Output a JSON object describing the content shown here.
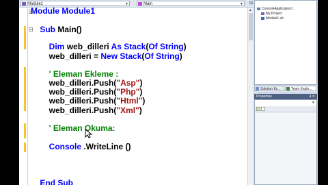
{
  "editor": {
    "class_dropdown": "Module1",
    "method_dropdown": "Main",
    "lines": [
      [
        {
          "t": "Module ",
          "c": "kw"
        },
        {
          "t": "Module1",
          "c": "kw"
        }
      ],
      [],
      [
        {
          "t": "    Sub ",
          "c": "kw"
        },
        {
          "t": "Main()",
          "c": "tx"
        }
      ],
      [],
      [
        {
          "t": "        Dim ",
          "c": "kw"
        },
        {
          "t": "web_dilleri ",
          "c": "tx"
        },
        {
          "t": "As Stack",
          "c": "kw"
        },
        {
          "t": "(",
          "c": "tx"
        },
        {
          "t": "Of String",
          "c": "kw"
        },
        {
          "t": ")",
          "c": "tx"
        }
      ],
      [
        {
          "t": "        web_dilleri = ",
          "c": "tx"
        },
        {
          "t": "New Stack",
          "c": "kw"
        },
        {
          "t": "(",
          "c": "tx"
        },
        {
          "t": "Of String",
          "c": "kw"
        },
        {
          "t": ")",
          "c": "tx"
        }
      ],
      [],
      [
        {
          "t": "        ' Eleman Ekleme :",
          "c": "cm"
        }
      ],
      [
        {
          "t": "        web_dilleri.Push(",
          "c": "tx"
        },
        {
          "t": "\"Asp\"",
          "c": "str"
        },
        {
          "t": ")",
          "c": "tx"
        }
      ],
      [
        {
          "t": "        web_dilleri.Push(",
          "c": "tx"
        },
        {
          "t": "\"Php\"",
          "c": "str"
        },
        {
          "t": ")",
          "c": "tx"
        }
      ],
      [
        {
          "t": "        web_dilleri.Push(",
          "c": "tx"
        },
        {
          "t": "\"Html\"",
          "c": "str"
        },
        {
          "t": ")",
          "c": "tx"
        }
      ],
      [
        {
          "t": "        web_dilleri.Push(",
          "c": "tx"
        },
        {
          "t": "\"Xml\"",
          "c": "str"
        },
        {
          "t": ")",
          "c": "tx"
        }
      ],
      [],
      [
        {
          "t": "        ' Eleman Okuma:",
          "c": "cm"
        }
      ],
      [],
      [
        {
          "t": "        Console ",
          "c": "kw"
        },
        {
          "t": ".WriteLine ()",
          "c": "tx"
        }
      ],
      [],
      [],
      [],
      [
        {
          "t": "    End Sub",
          "c": "kw"
        }
      ]
    ]
  },
  "solution": {
    "items": [
      {
        "label": "ConsoleApplication1",
        "indent": 0
      },
      {
        "label": "My Project",
        "indent": 1
      },
      {
        "label": "Module1.vb",
        "indent": 1
      }
    ],
    "tabs": [
      "Solution Ex...",
      "Team Explo..."
    ]
  },
  "properties": {
    "title": "Properties",
    "pin": "▾ ✕"
  },
  "colors": {
    "keyword": "#0000ff",
    "string": "#a31515",
    "comment": "#008000",
    "text": "#000000"
  }
}
